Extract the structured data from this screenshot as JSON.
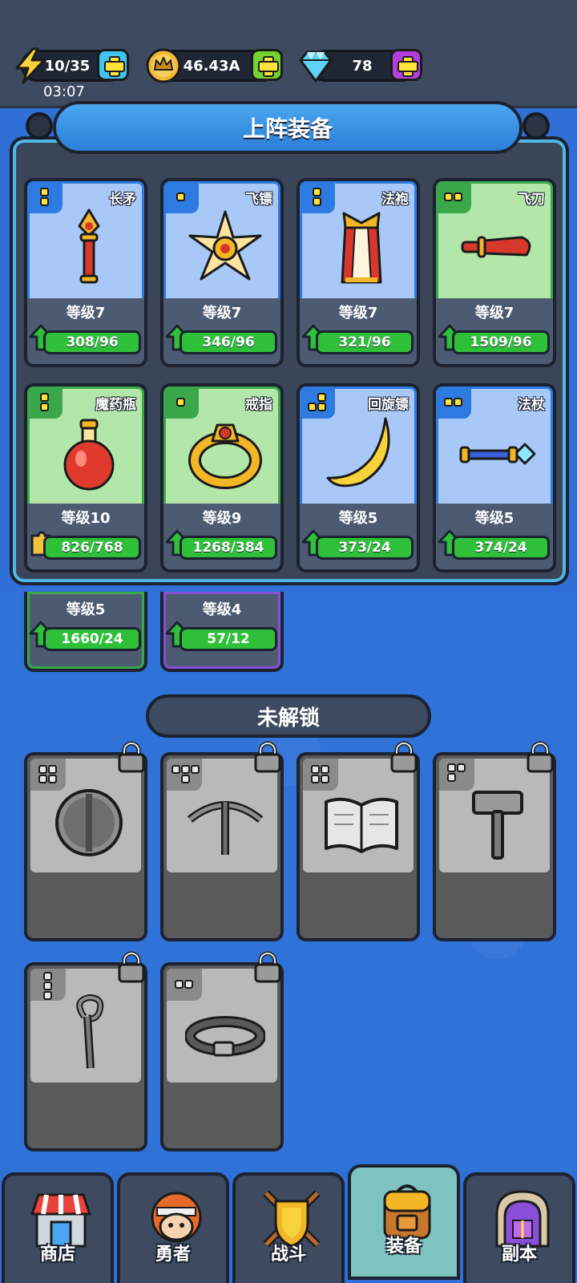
{
  "resources": {
    "energy": {
      "value": "10/35",
      "icon": "lightning-icon"
    },
    "gold": {
      "value": "46.43A",
      "icon": "crown-coin-icon"
    },
    "gems": {
      "value": "78",
      "icon": "diamond-icon"
    },
    "timer": "03:07"
  },
  "equipped": {
    "title": "上阵装备",
    "cards": [
      {
        "name": "长矛",
        "level": "等级7",
        "progress": "308/96",
        "rarity": "blue",
        "icon": "spear-icon"
      },
      {
        "name": "飞镖",
        "level": "等级7",
        "progress": "346/96",
        "rarity": "blue",
        "icon": "shuriken-icon"
      },
      {
        "name": "法袍",
        "level": "等级7",
        "progress": "321/96",
        "rarity": "blue",
        "icon": "robe-icon"
      },
      {
        "name": "飞刀",
        "level": "等级7",
        "progress": "1509/96",
        "rarity": "green",
        "icon": "flying-knife-icon"
      },
      {
        "name": "魔药瓶",
        "level": "等级10",
        "progress": "826/768",
        "rarity": "green",
        "icon": "potion-icon"
      },
      {
        "name": "戒指",
        "level": "等级9",
        "progress": "1268/384",
        "rarity": "green",
        "icon": "ring-icon"
      },
      {
        "name": "回旋镖",
        "level": "等级5",
        "progress": "373/24",
        "rarity": "blue",
        "icon": "boomerang-icon"
      },
      {
        "name": "法杖",
        "level": "等级5",
        "progress": "374/24",
        "rarity": "blue",
        "icon": "wand-icon"
      }
    ],
    "peek": [
      {
        "level": "等级5",
        "progress": "1660/24"
      },
      {
        "level": "等级4",
        "progress": "57/12"
      }
    ]
  },
  "locked": {
    "title": "未解锁",
    "cards": [
      {
        "icon": "shield-icon"
      },
      {
        "icon": "crossbow-icon"
      },
      {
        "icon": "book-icon"
      },
      {
        "icon": "hammer-icon"
      },
      {
        "icon": "staff-icon"
      },
      {
        "icon": "belt-icon"
      }
    ]
  },
  "nav": [
    {
      "label": "商店",
      "icon": "shop-icon"
    },
    {
      "label": "勇者",
      "icon": "hero-icon"
    },
    {
      "label": "战斗",
      "icon": "battle-icon"
    },
    {
      "label": "装备",
      "icon": "backpack-icon",
      "active": true
    },
    {
      "label": "副本",
      "icon": "dungeon-icon"
    }
  ],
  "colors": {
    "blue_rarity": "#2d7be0",
    "green_rarity": "#3aa84a",
    "purple_rarity": "#8a4fd8",
    "progress_green": "#2fc03a",
    "background": "#2f72d8"
  }
}
